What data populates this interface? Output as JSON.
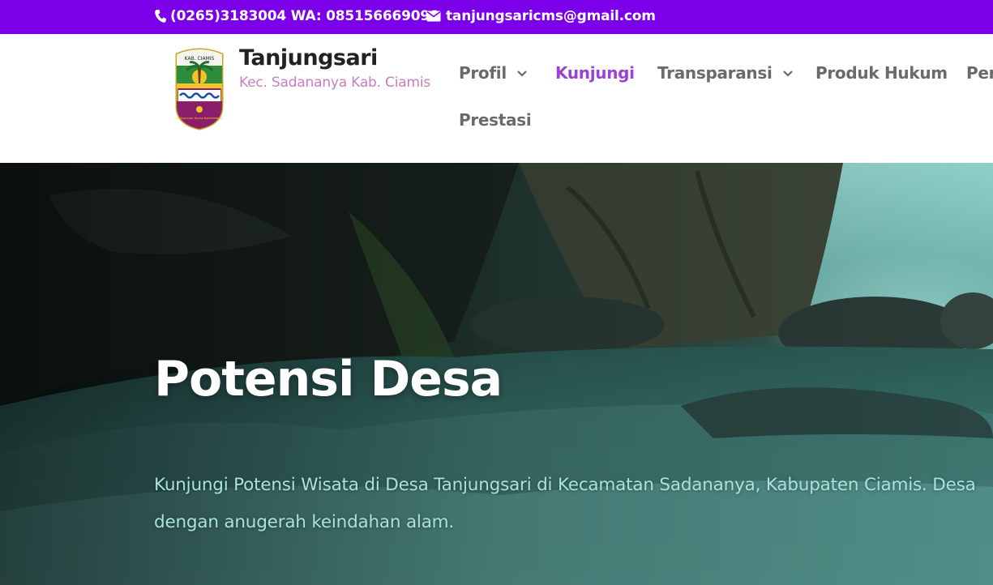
{
  "topbar": {
    "phone": "(0265)3183004 WA: 085156669090",
    "email": "tanjungsaricms@gmail.com",
    "background": "#7b00e9"
  },
  "header": {
    "site_title": "Tanjungsari",
    "tagline": "Kec. Sadananya Kab. Ciamis",
    "logo_top_text": "KAB. CIAMIS",
    "logo_motto": "Mahayunan Ayuna Kadaluwarsa"
  },
  "nav": {
    "items": [
      {
        "label": "Profil",
        "has_dropdown": true
      },
      {
        "label": "Kunjungi",
        "active": true
      },
      {
        "label": "Transparansi",
        "has_dropdown": true
      },
      {
        "label": "Produk Hukum"
      },
      {
        "label": "Per"
      },
      {
        "label": "Prestasi"
      }
    ],
    "active_color": "#9b40d8",
    "text_color": "#6a6a6a"
  },
  "hero": {
    "title": "Potensi Desa",
    "text": "Kunjungi Potensi Wisata di Desa Tanjungsari di Kecamatan Sadananya, Kabupaten Ciamis. Desa dengan anugerah keindahan alam."
  }
}
